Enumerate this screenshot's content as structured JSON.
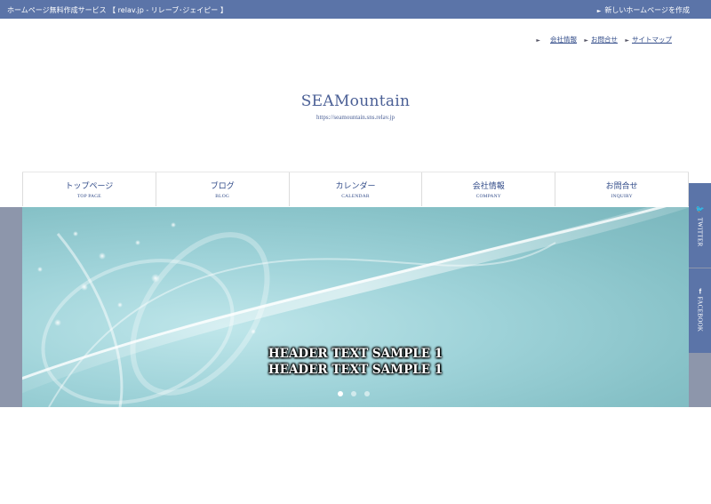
{
  "topbar": {
    "left_text": "ホームページ無料作成サービス 【 relav.jp - リレーブ･ジェイピー 】",
    "right_text": "新しいホームページを作成",
    "bg_color": "#5b74a8"
  },
  "util_links": [
    "会社情報",
    "お問合せ",
    "サイトマップ"
  ],
  "site": {
    "title": "SEAMountain",
    "url": "https://seamountain.sns.relav.jp"
  },
  "nav": [
    {
      "jp": "トップページ",
      "en": "TOP PAGE"
    },
    {
      "jp": "ブログ",
      "en": "BLOG"
    },
    {
      "jp": "カレンダー",
      "en": "CALENDAR"
    },
    {
      "jp": "会社情報",
      "en": "COMPANY"
    },
    {
      "jp": "お問合せ",
      "en": "INQUIRY"
    }
  ],
  "hero": {
    "line1": "HEADER TEXT SAMPLE 1",
    "line2": "HEADER TEXT SAMPLE 1",
    "slide_count": 3,
    "active_slide": 1
  },
  "social": {
    "twitter": "TWITTER",
    "twitter_icon": "twitter-bird-icon",
    "facebook": "FACEBOOK",
    "facebook_icon": "facebook-f-icon"
  }
}
